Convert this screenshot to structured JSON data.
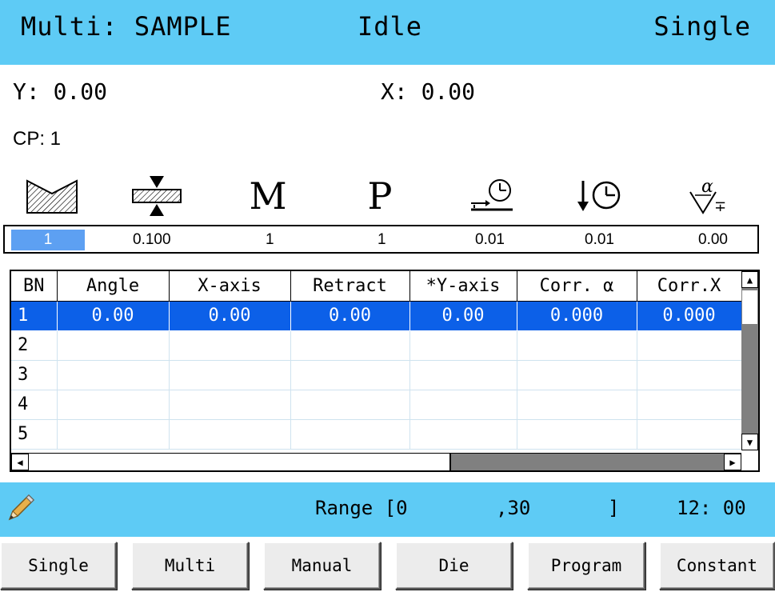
{
  "header": {
    "title": "Multi: SAMPLE",
    "state": "Idle",
    "mode": "Single"
  },
  "coords": {
    "y": "Y: 0.00",
    "x": "X: 0.00",
    "cp": "CP: 1"
  },
  "param_icons": [
    "die-profile-icon",
    "thickness-icon",
    "material-icon",
    "punch-icon",
    "speed-change-icon",
    "pressure-time-icon",
    "angle-tolerance-icon"
  ],
  "param_letters": {
    "material": "M",
    "punch": "P"
  },
  "params": [
    "1",
    "0.100",
    "1",
    "1",
    "0.01",
    "0.01",
    "0.00"
  ],
  "table": {
    "columns": [
      "BN",
      "Angle",
      "X-axis",
      "Retract",
      "*Y-axis",
      "Corr. α",
      "Corr.X"
    ],
    "rows": [
      [
        "1",
        "0.00",
        "0.00",
        "0.00",
        "0.00",
        "0.000",
        "0.000"
      ],
      [
        "2",
        "",
        "",
        "",
        "",
        "",
        ""
      ],
      [
        "3",
        "",
        "",
        "",
        "",
        "",
        ""
      ],
      [
        "4",
        "",
        "",
        "",
        "",
        "",
        ""
      ],
      [
        "5",
        "",
        "",
        "",
        "",
        "",
        ""
      ]
    ],
    "selected_row": 0
  },
  "status": {
    "range_label": "Range [0",
    "range_max": ",30",
    "range_close": "]",
    "time": "12: 00"
  },
  "buttons": [
    "Single",
    "Multi",
    "Manual",
    "Die",
    "Program",
    "Constant"
  ],
  "colors": {
    "header_bg": "#5ecbf5",
    "selection": "#0c60e8",
    "value_highlight": "#5da0f2"
  }
}
